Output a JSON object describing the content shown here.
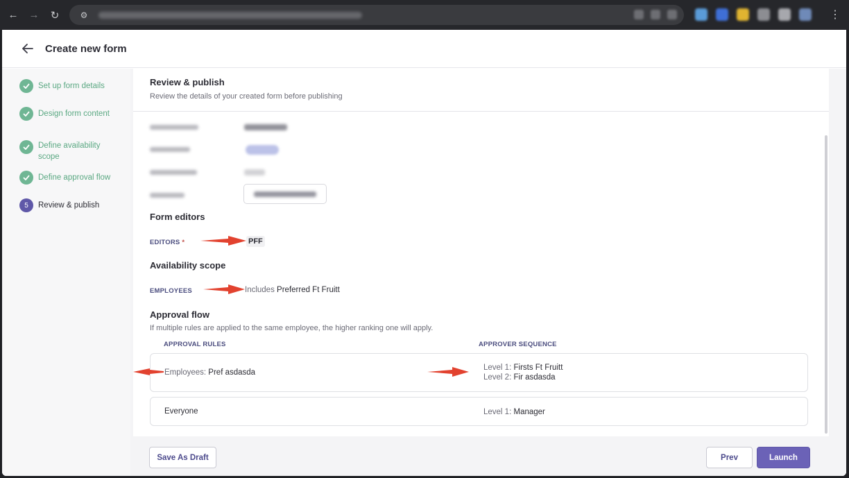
{
  "app": {
    "title": "Create new form"
  },
  "steps": [
    {
      "label": "Set up form details",
      "status": "done"
    },
    {
      "label": "Design form content",
      "status": "done"
    },
    {
      "label": "Define availability scope",
      "status": "done"
    },
    {
      "label": "Define approval flow",
      "status": "done"
    },
    {
      "label": "Review & publish",
      "status": "current",
      "number": "5"
    }
  ],
  "review": {
    "title": "Review & publish",
    "subtitle": "Review the details of your created form before publishing"
  },
  "form_editors": {
    "title": "Form editors",
    "label": "EDITORS",
    "required_mark": "*",
    "value": "PFF"
  },
  "availability": {
    "title": "Availability scope",
    "label": "EMPLOYEES",
    "prefix": "Includes",
    "value": "Preferred Ft Fruitt"
  },
  "approval": {
    "title": "Approval flow",
    "note": "If multiple rules are applied to the same employee, the higher ranking one will apply.",
    "col_rules": "APPROVAL RULES",
    "col_sequence": "APPROVER SEQUENCE",
    "rules": [
      {
        "rule_key": "Employees:",
        "rule_value": "Pref asdasda",
        "levels": [
          {
            "key": "Level 1:",
            "value": "Firsts Ft Fruitt"
          },
          {
            "key": "Level 2:",
            "value": "Fir asdasda"
          }
        ]
      },
      {
        "rule_key": "",
        "rule_value": "Everyone",
        "levels": [
          {
            "key": "Level 1:",
            "value": "Manager"
          }
        ]
      }
    ]
  },
  "footer": {
    "save_draft": "Save As Draft",
    "prev": "Prev",
    "launch": "Launch"
  },
  "colors": {
    "accent": "#6b62b7",
    "step_done": "#6fb694",
    "annotation_arrow": "#e2422f"
  }
}
